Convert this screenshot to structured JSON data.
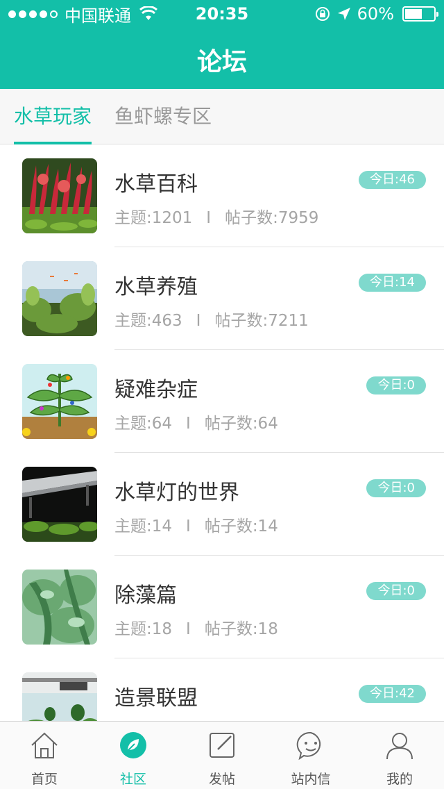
{
  "status_bar": {
    "carrier": "中国联通",
    "time": "20:35",
    "battery": "60%",
    "battery_level": 0.6
  },
  "header": {
    "title": "论坛"
  },
  "tabs": [
    {
      "label": "水草玩家",
      "active": true
    },
    {
      "label": "鱼虾螺专区",
      "active": false
    }
  ],
  "forums": [
    {
      "title": "水草百科",
      "topics": "主题:1201",
      "sep": "I",
      "posts": "帖子数:7959",
      "today": "今日:46",
      "icon": "red-aquatic-plant-thumbnail"
    },
    {
      "title": "水草养殖",
      "topics": "主题:463",
      "sep": "I",
      "posts": "帖子数:7211",
      "today": "今日:14",
      "icon": "planted-aquarium-thumbnail"
    },
    {
      "title": "疑难杂症",
      "topics": "主题:64",
      "sep": "I",
      "posts": "帖子数:64",
      "today": "今日:0",
      "icon": "plant-diagram-thumbnail"
    },
    {
      "title": "水草灯的世界",
      "topics": "主题:14",
      "sep": "I",
      "posts": "帖子数:14",
      "today": "今日:0",
      "icon": "aquarium-light-thumbnail"
    },
    {
      "title": "除藻篇",
      "topics": "主题:18",
      "sep": "I",
      "posts": "帖子数:18",
      "today": "今日:0",
      "icon": "leaf-closeup-thumbnail"
    },
    {
      "title": "造景联盟",
      "topics": "",
      "sep": "",
      "posts": "",
      "today": "今日:42",
      "icon": "aquascape-tanks-thumbnail"
    }
  ],
  "tab_bar": [
    {
      "label": "首页",
      "icon": "home-icon",
      "active": false
    },
    {
      "label": "社区",
      "icon": "community-icon",
      "active": true
    },
    {
      "label": "发帖",
      "icon": "compose-icon",
      "active": false
    },
    {
      "label": "站内信",
      "icon": "message-icon",
      "active": false
    },
    {
      "label": "我的",
      "icon": "profile-icon",
      "active": false
    }
  ],
  "colors": {
    "accent": "#13bfa8",
    "badge": "#7fd9cd",
    "meta_text": "#a5a5a5"
  }
}
